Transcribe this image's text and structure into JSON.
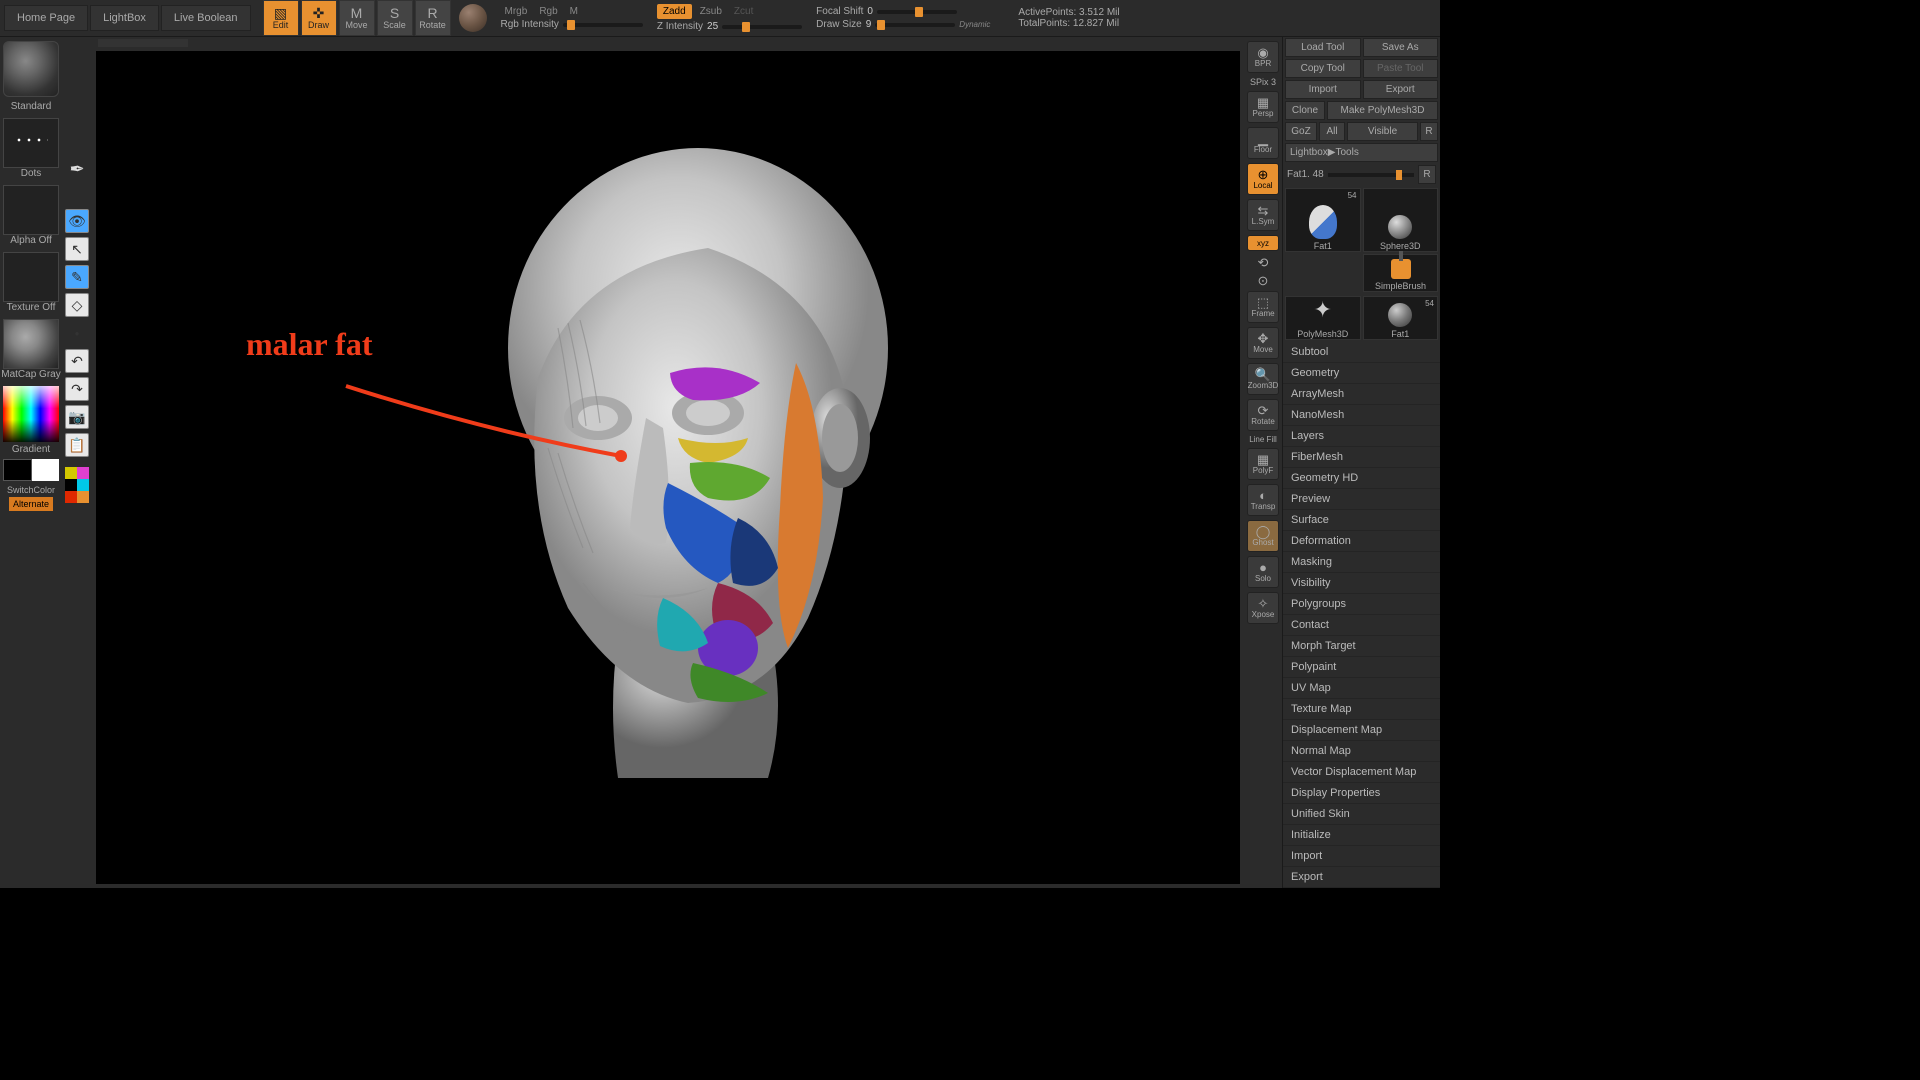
{
  "topbar": {
    "home": "Home Page",
    "lightbox": "LightBox",
    "liveboolean": "Live Boolean",
    "modes": {
      "edit": "Edit",
      "draw": "Draw",
      "move": "Move",
      "scale": "Scale",
      "rotate": "Rotate"
    },
    "rgb": {
      "mrgb": "Mrgb",
      "rgb": "Rgb",
      "m": "M",
      "intensity": "Rgb Intensity"
    },
    "zmode": {
      "zadd": "Zadd",
      "zsub": "Zsub",
      "zcut": "Zcut",
      "zintensity_label": "Z Intensity",
      "zintensity_val": "25"
    },
    "focal": {
      "label": "Focal Shift",
      "val": "0"
    },
    "drawsize": {
      "label": "Draw Size",
      "val": "9"
    },
    "dynamic": "Dynamic",
    "stats": {
      "active_label": "ActivePoints:",
      "active_val": "3.512 Mil",
      "total_label": "TotalPoints:",
      "total_val": "12.827 Mil"
    }
  },
  "left": {
    "standard": "Standard",
    "dots": "Dots",
    "alpha_off": "Alpha Off",
    "texture_off": "Texture Off",
    "matcap": "MatCap Gray",
    "gradient": "Gradient",
    "switch": "SwitchColor",
    "alternate": "Alternate"
  },
  "annotation": "malar fat",
  "right_shelf": {
    "bpr": "BPR",
    "spix": "SPix 3",
    "persp": "Persp",
    "floor": "Floor",
    "local": "Local",
    "lsym": "L.Sym",
    "xyz": "xyz",
    "frame": "Frame",
    "move": "Move",
    "zoom": "Zoom3D",
    "rotate": "Rotate",
    "linefill": "Line Fill",
    "polyf": "PolyF",
    "transp": "Transp",
    "ghost": "Ghost",
    "solo": "Solo",
    "xpose": "Xpose"
  },
  "right_panel": {
    "r1": {
      "load": "Load Tool",
      "save": "Save As"
    },
    "r2": {
      "copy": "Copy Tool",
      "paste": "Paste Tool"
    },
    "r3": {
      "import": "Import",
      "export": "Export"
    },
    "r4": {
      "clone": "Clone",
      "make": "Make PolyMesh3D"
    },
    "r5": {
      "goz": "GoZ",
      "all": "All",
      "visible": "Visible",
      "r": "R"
    },
    "r6": "Lightbox▶Tools",
    "r7": {
      "name": "Fat1. 48",
      "r": "R"
    },
    "tools": {
      "t1": "Fat1",
      "t1b": "54",
      "t2": "Sphere3D",
      "t3": "SimpleBrush",
      "t4": "PolyMesh3D",
      "t5": "Fat1",
      "t5b": "54"
    },
    "sections": [
      "Subtool",
      "Geometry",
      "ArrayMesh",
      "NanoMesh",
      "Layers",
      "FiberMesh",
      "Geometry HD",
      "Preview",
      "Surface",
      "Deformation",
      "Masking",
      "Visibility",
      "Polygroups",
      "Contact",
      "Morph Target",
      "Polypaint",
      "UV Map",
      "Texture Map",
      "Displacement Map",
      "Normal Map",
      "Vector Displacement Map",
      "Display Properties",
      "Unified Skin",
      "Initialize",
      "Import",
      "Export"
    ]
  }
}
